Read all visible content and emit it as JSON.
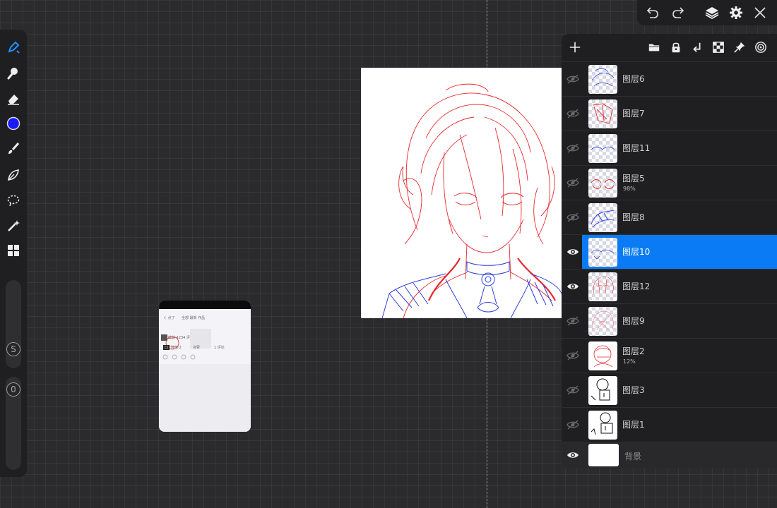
{
  "layers_panel": {
    "layers": [
      {
        "name": "图层6",
        "opacity": "",
        "visible": false,
        "selected": false
      },
      {
        "name": "图层7",
        "opacity": "",
        "visible": false,
        "selected": false
      },
      {
        "name": "图层11",
        "opacity": "",
        "visible": false,
        "selected": false
      },
      {
        "name": "图层5",
        "opacity": "98%",
        "visible": false,
        "selected": false
      },
      {
        "name": "图层8",
        "opacity": "",
        "visible": false,
        "selected": false
      },
      {
        "name": "图层10",
        "opacity": "",
        "visible": true,
        "selected": true
      },
      {
        "name": "图层12",
        "opacity": "",
        "visible": true,
        "selected": false
      },
      {
        "name": "图层9",
        "opacity": "",
        "visible": false,
        "selected": false
      },
      {
        "name": "图层2",
        "opacity": "12%",
        "visible": false,
        "selected": false
      },
      {
        "name": "图层3",
        "opacity": "",
        "visible": false,
        "selected": false
      },
      {
        "name": "图层1",
        "opacity": "",
        "visible": false,
        "selected": false
      }
    ],
    "background": {
      "name": "背景",
      "visible": true
    },
    "header_icons": [
      "add-icon",
      "folder-icon",
      "lock-icon",
      "merge-down-icon",
      "checker-icon",
      "pin-icon",
      "target-icon"
    ]
  },
  "left_toolbar": {
    "tools": [
      "brush-icon",
      "smudge-icon",
      "eraser-icon",
      "color-swatch",
      "brush-settings-icon",
      "pen-icon",
      "lasso-icon",
      "magic-wand-icon",
      "grid-icon"
    ],
    "active_color": "#1a1aff",
    "size_slider_label": "S",
    "opacity_slider_label": "0"
  },
  "top_toolbar": {
    "icons": [
      "undo-icon",
      "redo-icon",
      "layers-icon",
      "settings-gear-icon",
      "close-icon"
    ]
  },
  "reference_window": {
    "title_left": "く 点了",
    "title_mid": "全部 最新 作品",
    "item_label": "转给 1234 评论",
    "chips": [
      "口",
      "转给 2",
      "点赞",
      "1 评论"
    ]
  },
  "colors": {
    "accent": "#0a7bf5",
    "stroke_red": "#e8282e",
    "stroke_blue": "#2f3fd8"
  }
}
